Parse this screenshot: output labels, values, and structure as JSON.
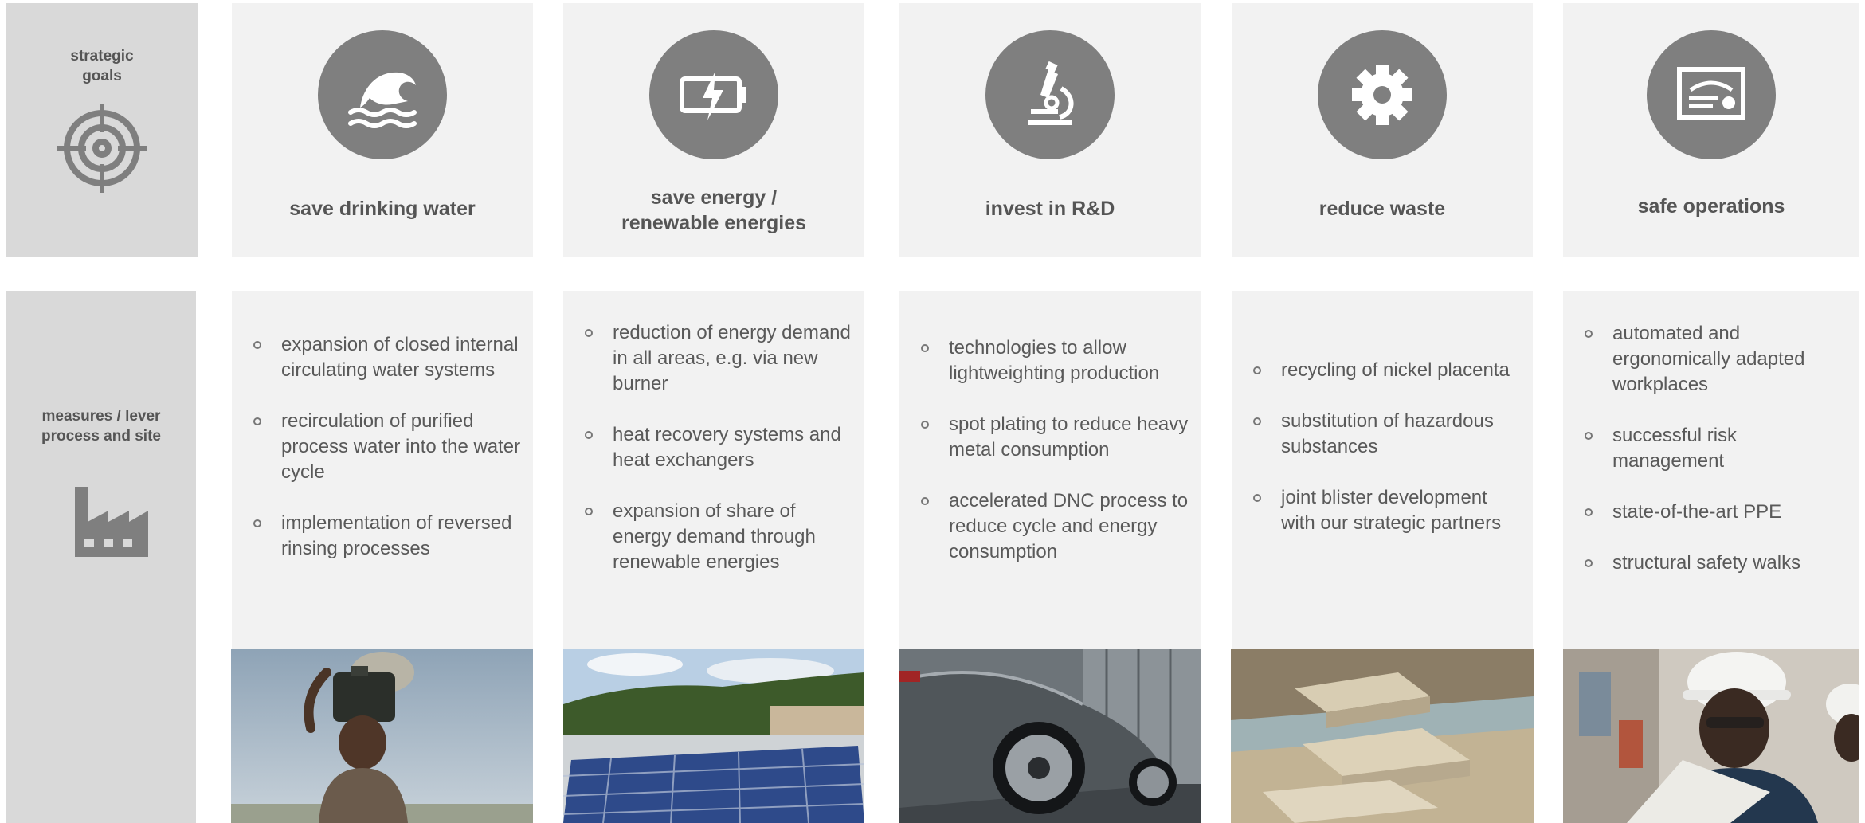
{
  "sidebar": {
    "goals_label": "strategic\ngoals",
    "goals_icon": "target-icon",
    "measures_label": "measures / lever\nprocess and site",
    "measures_icon": "factory-icon"
  },
  "goals": [
    {
      "title": "save drinking water",
      "icon": "wave-icon"
    },
    {
      "title": "save energy /\nrenewable energies",
      "icon": "battery-charge-icon"
    },
    {
      "title": "invest in R&D",
      "icon": "microscope-icon"
    },
    {
      "title": "reduce waste",
      "icon": "gear-icon"
    },
    {
      "title": "safe operations",
      "icon": "certificate-icon"
    }
  ],
  "measures": [
    {
      "items": [
        "expansion of closed internal circulating water systems",
        "recirculation of purified process water into the water cycle",
        "implementation of reversed rinsing processes"
      ],
      "photo": "child-carrying-water-canister-photo"
    },
    {
      "items": [
        "reduction of energy demand in all areas, e.g. via new burner",
        "heat recovery systems and heat exchangers",
        "expansion of share of energy demand through renewable energies"
      ],
      "photo": "solar-panels-roof-photo"
    },
    {
      "items": [
        "technologies to allow lightweighting production",
        "spot plating to reduce heavy metal consumption",
        "accelerated DNC process to reduce cycle and energy consumption"
      ],
      "photo": "sports-car-photo"
    },
    {
      "items": [
        "recycling of nickel placenta",
        "substitution of hazardous substances",
        "joint blister development with our strategic partners"
      ],
      "photo": "nickel-placenta-photo"
    },
    {
      "items": [
        "automated and ergonomically adapted workplaces",
        "successful risk management",
        "state-of-the-art PPE",
        "structural safety walks"
      ],
      "photo": "engineer-with-helmet-photo"
    }
  ],
  "colors": {
    "panel": "#f2f2f2",
    "sidebar": "#d9d9d9",
    "icon_circle": "#7f7f7f",
    "text": "#555555"
  }
}
